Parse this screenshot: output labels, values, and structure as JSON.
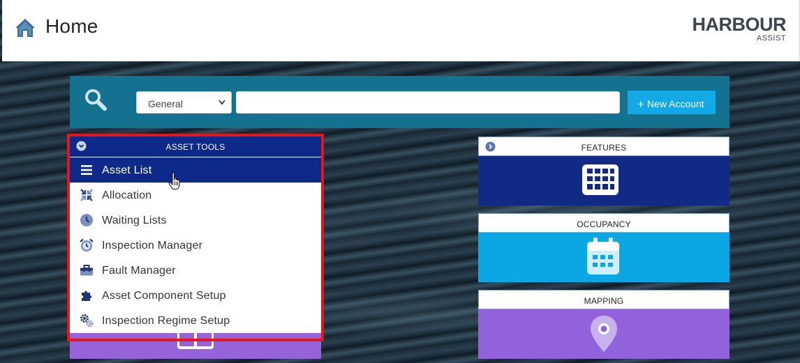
{
  "header": {
    "title": "Home",
    "logo_main": "HARBOUR",
    "logo_sub": "ASSIST"
  },
  "search": {
    "category_selected": "General",
    "input_value": "",
    "new_account_label": "New Account"
  },
  "asset_tools": {
    "title": "ASSET TOOLS",
    "items": [
      {
        "label": "Asset List",
        "icon": "list-icon",
        "active": true
      },
      {
        "label": "Allocation",
        "icon": "arrows-in-icon"
      },
      {
        "label": "Waiting Lists",
        "icon": "clock-icon"
      },
      {
        "label": "Inspection Manager",
        "icon": "alarm-clock-icon"
      },
      {
        "label": "Fault Manager",
        "icon": "toolbox-icon"
      },
      {
        "label": "Asset Component Setup",
        "icon": "puzzle-icon"
      },
      {
        "label": "Inspection Regime Setup",
        "icon": "gears-icon"
      }
    ]
  },
  "tiles": [
    {
      "title": "FEATURES",
      "icon": "grid-icon",
      "color": "#102a86"
    },
    {
      "title": "OCCUPANCY",
      "icon": "calendar-icon",
      "color": "#0aa7e4"
    },
    {
      "title": "MAPPING",
      "icon": "map-pin-icon",
      "color": "#9261dc"
    }
  ],
  "colors": {
    "header_bg": "#ffffff",
    "search_bar_bg": "#14718f",
    "primary_navy": "#0d2a8a",
    "button_blue": "#13a8e6",
    "highlight_red": "#e8141b"
  }
}
